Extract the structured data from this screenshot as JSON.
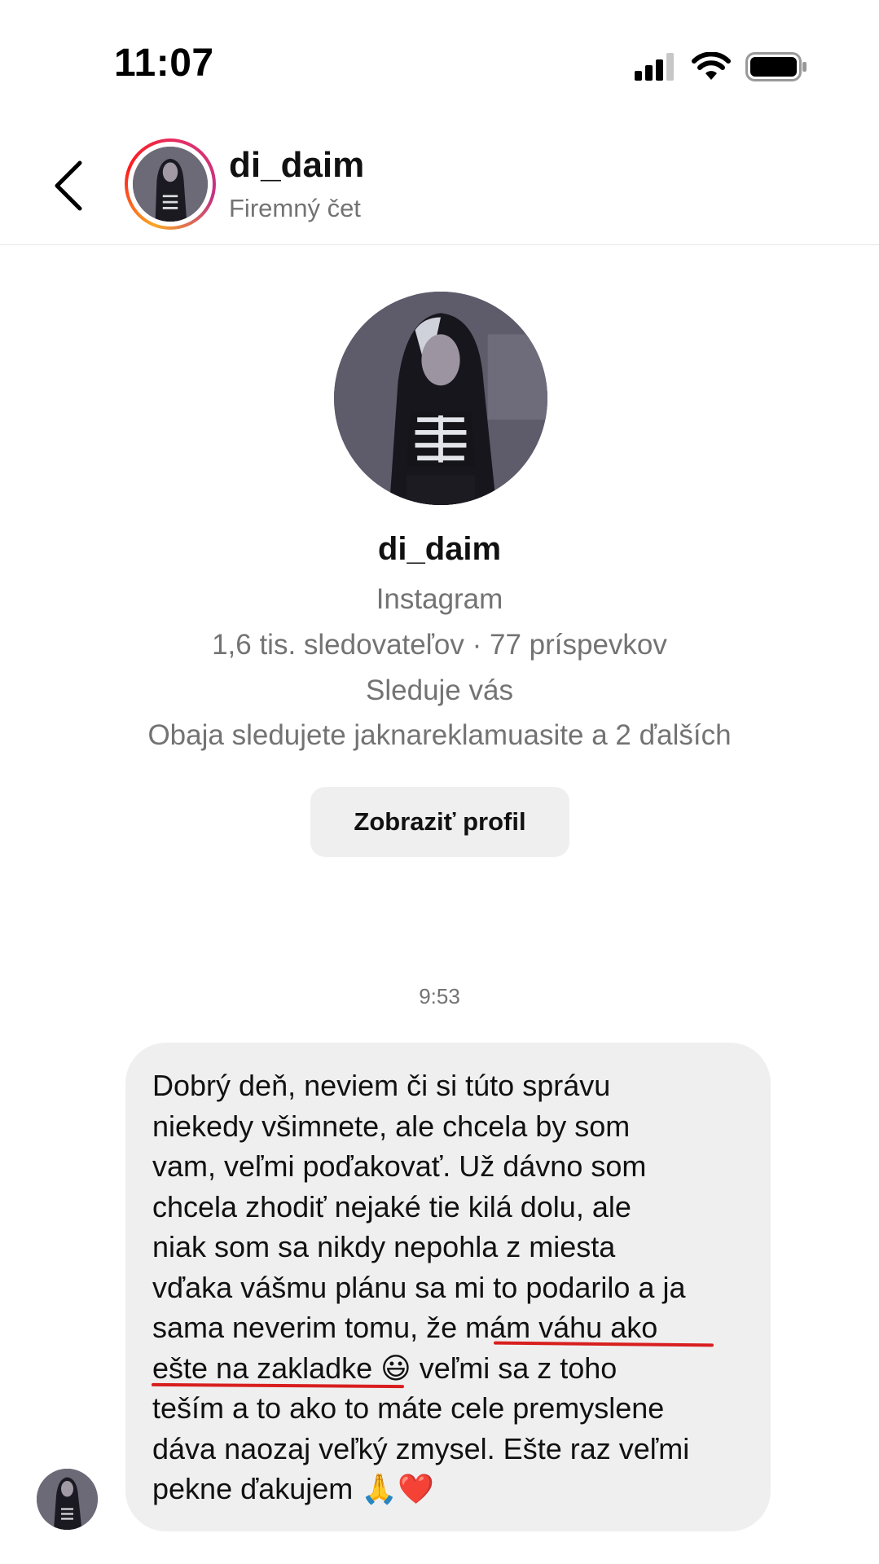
{
  "status_bar": {
    "time": "11:07",
    "icons": [
      "cellular-signal-icon",
      "wifi-icon",
      "battery-icon"
    ]
  },
  "header": {
    "username": "di_daim",
    "subtitle": "Firemný čet"
  },
  "profile": {
    "username": "di_daim",
    "platform": "Instagram",
    "stats": "1,6 tis. sledovateľov · 77 príspevkov",
    "follow_status": "Sleduje vás",
    "mutual": "Obaja sledujete jaknareklamuasite a 2 ďalších",
    "view_profile_label": "Zobraziť profil"
  },
  "conversation": {
    "timestamp": "9:53",
    "message": "Dobrý deň, neviem či si túto správu\nniekedy všimnete, ale chcela by som\nvam, veľmi poďakovať. Už dávno som\nchcela zhodiť nejaké tie kilá dolu, ale\nniak som sa nikdy nepohla z miesta\nvďaka vášmu plánu sa mi to podarilo a ja\nsama neverim tomu, že mám váhu ako\nešte na zakladke 😃 veľmi sa z toho\nteším a to ako to máte cele premyslene\ndáva naozaj veľký zmysel. Ešte raz veľmi\npekne ďakujem 🙏❤️",
    "highlight_color": "#d81e1e"
  },
  "colors": {
    "secondary_text": "#737373",
    "bubble_bg": "#efeff0",
    "button_bg": "#efeff0"
  }
}
